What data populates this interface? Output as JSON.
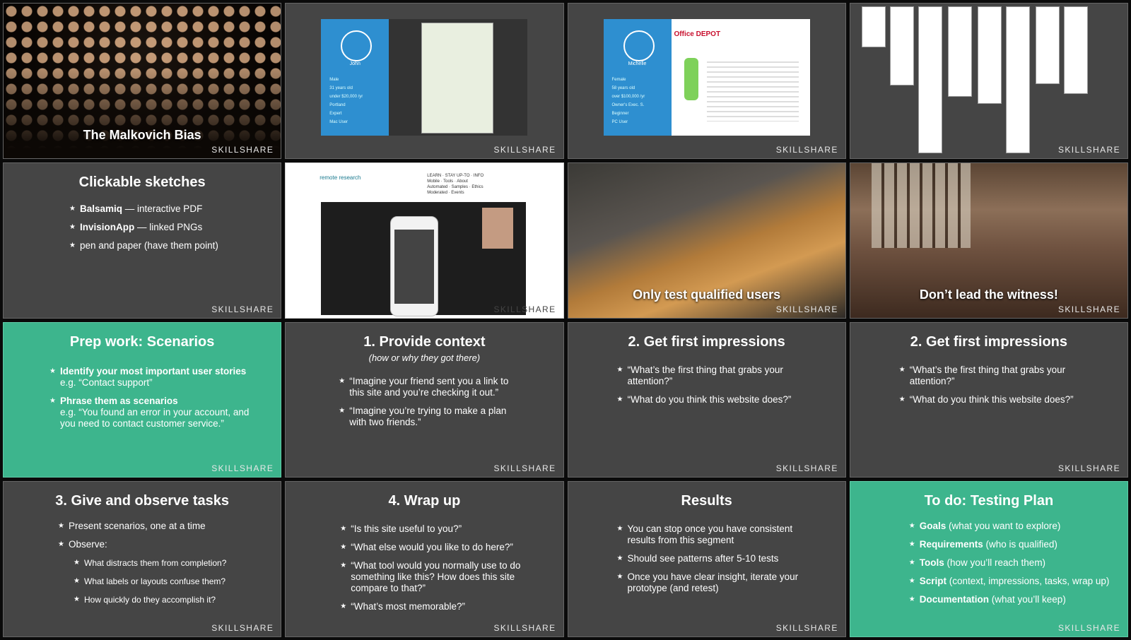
{
  "brand": "SKILLSHARE",
  "slides": {
    "s1": {
      "caption": "The Malkovich Bias"
    },
    "s2": {
      "name": "John",
      "lines": [
        "Male",
        "31 years old",
        "under $20,000 /yr",
        "Portland",
        "Expert",
        "Mac User"
      ]
    },
    "s3": {
      "name": "Michelle",
      "lines": [
        "Female",
        "58 years old",
        "over $100,000 /yr",
        "Owner's Exec. S.",
        "Beginner",
        "PC User"
      ],
      "logo": "Office DEPOT"
    },
    "s5": {
      "title": "Clickable sketches",
      "items": [
        {
          "strong": "Balsamiq",
          "rest": " — interactive PDF"
        },
        {
          "strong": "InvisionApp",
          "rest": " — linked PNGs"
        },
        {
          "strong": "",
          "rest": "pen and paper (have them point)"
        }
      ]
    },
    "s6": {
      "logo": "remote research",
      "nav": [
        "LEARN",
        "Mobile",
        "Automated",
        "Moderated",
        "STAY UP-TO",
        "Tools",
        "Samples",
        "Events",
        "INFO",
        "About",
        "Ethics"
      ]
    },
    "s7": {
      "caption": "Only test qualified users"
    },
    "s8": {
      "caption": "Don’t lead the witness!"
    },
    "s9": {
      "title": "Prep work: Scenarios",
      "items": [
        {
          "strong": "Identify your most important user stories",
          "rest": "e.g. “Contact support”"
        },
        {
          "strong": "Phrase them as scenarios",
          "rest": "e.g. “You found an error in your account, and you need to contact customer service.”"
        }
      ]
    },
    "s10": {
      "title": "1. Provide context",
      "subtitle": "(how or why they got there)",
      "items": [
        "“Imagine your friend sent you a link to this site and you’re checking it out.”",
        "“Imagine you’re trying to make a plan with two friends.”"
      ]
    },
    "s11": {
      "title": "2. Get first impressions",
      "items": [
        "“What’s the first thing that grabs your attention?”",
        "“What do you think this website does?”"
      ]
    },
    "s12": {
      "title": "2. Get first impressions",
      "items": [
        "“What’s the first thing that grabs your attention?”",
        "“What do you think this website does?”"
      ]
    },
    "s13": {
      "title": "3. Give and observe tasks",
      "items": [
        "Present scenarios, one at a time",
        "Observe:"
      ],
      "subitems": [
        "What distracts them from completion?",
        "What labels or layouts confuse them?",
        "How quickly do they accomplish it?"
      ]
    },
    "s14": {
      "title": "4. Wrap up",
      "items": [
        "“Is this site useful to you?”",
        "“What else would you like to do here?”",
        "“What tool would you normally use to do something like this? How does this site compare to that?”",
        "“What’s most memorable?”"
      ]
    },
    "s15": {
      "title": "Results",
      "items": [
        "You can stop once you have consistent results from this segment",
        "Should see patterns after 5-10 tests",
        "Once you have clear insight, iterate your prototype (and retest)"
      ]
    },
    "s16": {
      "title": "To do: Testing Plan",
      "items": [
        {
          "strong": "Goals",
          "rest": " (what you want to explore)"
        },
        {
          "strong": "Requirements",
          "rest": " (who is qualified)"
        },
        {
          "strong": "Tools",
          "rest": " (how you’ll reach them)"
        },
        {
          "strong": "Script",
          "rest": " (context, impressions, tasks, wrap up)"
        },
        {
          "strong": "Documentation",
          "rest": " (what you’ll keep)"
        }
      ]
    }
  }
}
